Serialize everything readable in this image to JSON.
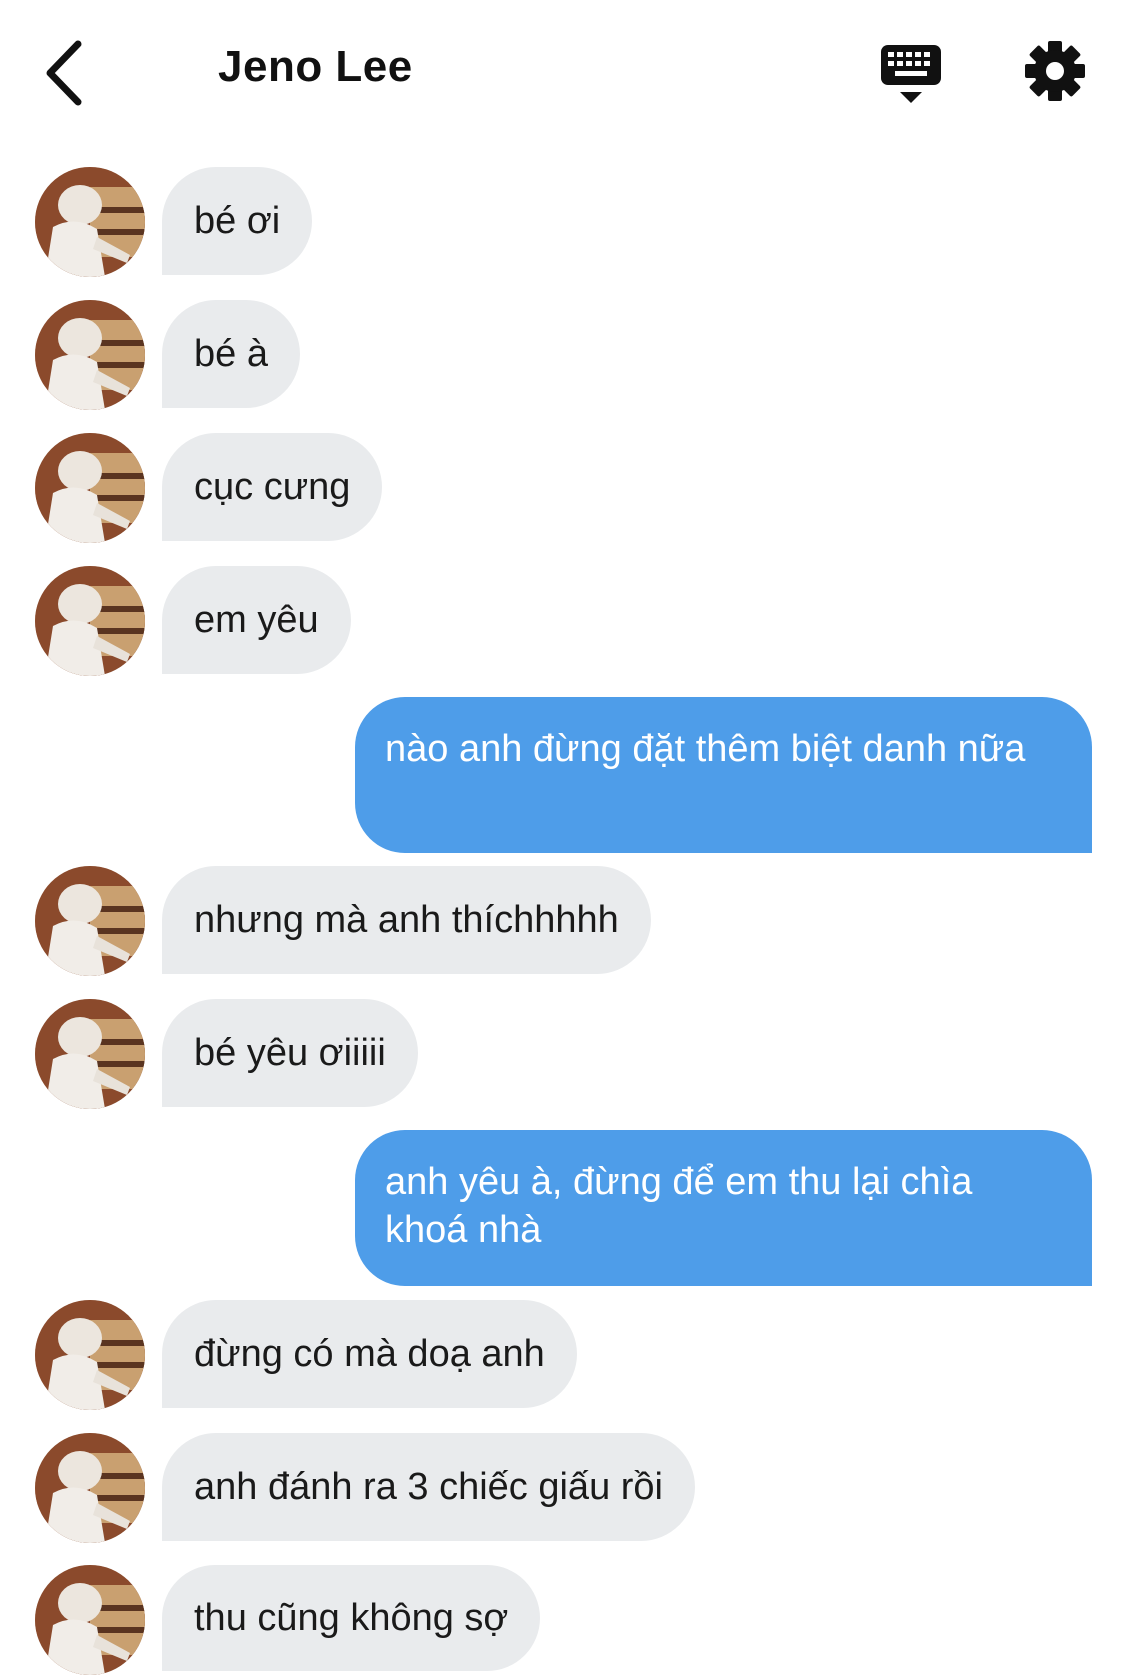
{
  "header": {
    "title": "Jeno Lee",
    "back_icon": "chevron-left-icon",
    "keyboard_icon": "keyboard-icon",
    "settings_icon": "gear-icon"
  },
  "colors": {
    "outgoing_bubble": "#4e9de9",
    "incoming_bubble": "#e9ebed"
  },
  "messages": [
    {
      "from": "contact",
      "text": "bé ơi"
    },
    {
      "from": "contact",
      "text": "bé à"
    },
    {
      "from": "contact",
      "text": "cục cưng"
    },
    {
      "from": "contact",
      "text": "em yêu"
    },
    {
      "from": "me",
      "text": "nào anh đừng đặt thêm biệt danh nữa"
    },
    {
      "from": "contact",
      "text": "nhưng mà anh thíchhhhh"
    },
    {
      "from": "contact",
      "text": "bé yêu ơiiiii"
    },
    {
      "from": "me",
      "text": "anh yêu à, đừng để em thu lại chìa khoá nhà"
    },
    {
      "from": "contact",
      "text": "đừng có mà doạ anh"
    },
    {
      "from": "contact",
      "text": "anh đánh ra 3 chiếc giấu rồi"
    },
    {
      "from": "contact",
      "text": "thu cũng không sợ"
    }
  ]
}
